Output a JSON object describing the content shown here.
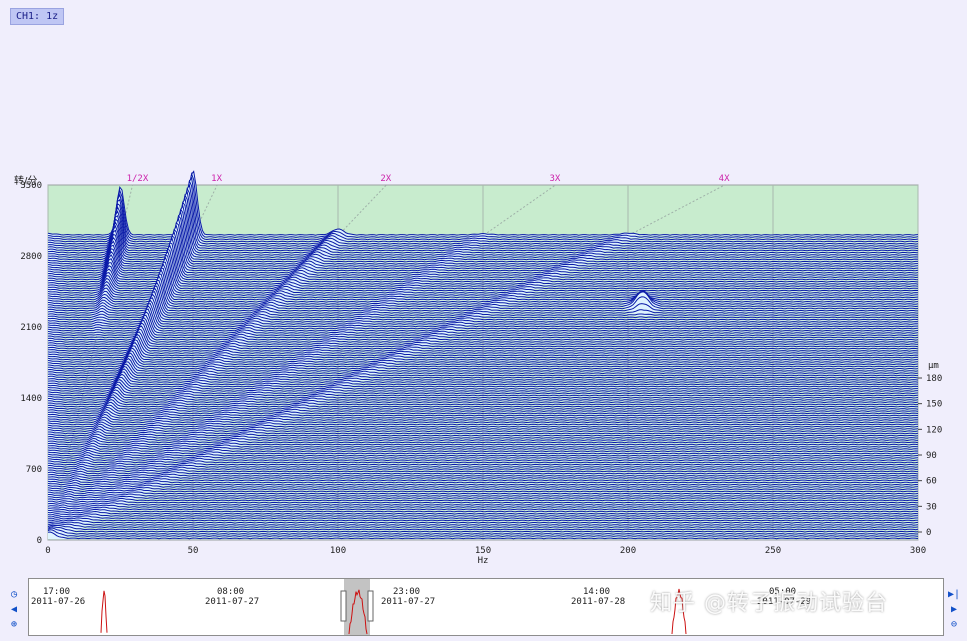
{
  "channel_label": "CH1: 1z",
  "chart_data": {
    "type": "waterfall",
    "xlabel": "Hz",
    "ylabel": "转/分",
    "zlabel": "μm",
    "xlim": [
      0,
      300
    ],
    "ylim": [
      0,
      3500
    ],
    "zlim": [
      0,
      180
    ],
    "x_ticks": [
      0,
      50,
      100,
      150,
      200,
      250,
      300
    ],
    "y_ticks": [
      0,
      700,
      1400,
      2100,
      2800,
      3500
    ],
    "z_ticks": [
      0,
      30,
      60,
      90,
      120,
      150,
      180
    ],
    "harmonic_lines": [
      {
        "label": "1/2X",
        "order": 0.5
      },
      {
        "label": "1X",
        "order": 1
      },
      {
        "label": "2X",
        "order": 2
      },
      {
        "label": "3X",
        "order": 3
      },
      {
        "label": "4X",
        "order": 4
      }
    ],
    "peaks": [
      {
        "frequency_hz": 25,
        "rpm": 3000,
        "amplitude_um": 115
      },
      {
        "frequency_hz": 50,
        "rpm": 3000,
        "amplitude_um": 160
      },
      {
        "frequency_hz": 100,
        "rpm": 3000,
        "amplitude_um": 15
      },
      {
        "frequency_hz": 205,
        "rpm": 2300,
        "amplitude_um": 35
      }
    ],
    "colors": {
      "plot_bg": "#c8ecce",
      "trace": "#0a1aa8",
      "fill": "#dff4ff",
      "harmonic": "#cc22aa"
    }
  },
  "timeline": {
    "markers": [
      {
        "time": "17:00",
        "date": "2011-07-26"
      },
      {
        "time": "08:00",
        "date": "2011-07-27"
      },
      {
        "time": "23:00",
        "date": "2011-07-27"
      },
      {
        "time": "14:00",
        "date": "2011-07-28"
      },
      {
        "time": "05:00",
        "date": "2011-07-29"
      }
    ]
  },
  "icons": {
    "left": [
      "clock-icon",
      "prev-icon",
      "zoom-in-icon"
    ],
    "right": [
      "next-end-icon",
      "next-icon",
      "zoom-out-icon"
    ]
  },
  "watermark": "知乎 @转子振动试验台"
}
